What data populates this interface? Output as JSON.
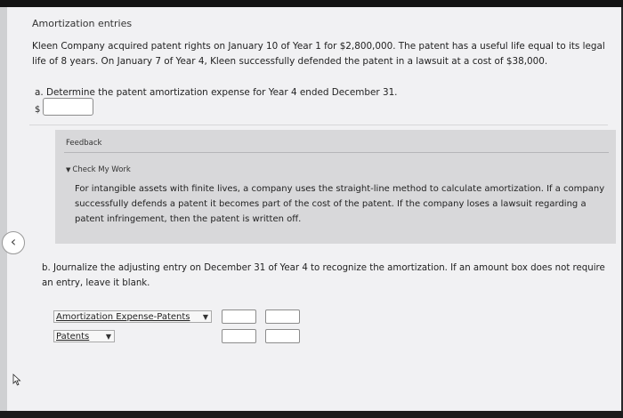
{
  "page": {
    "title": "Amortization entries",
    "description": "Kleen Company acquired patent rights on January 10 of Year 1 for $2,800,000. The patent has a useful life equal to its legal life of 8 years. On January 7 of Year 4, Kleen successfully defended the patent in a lawsuit at a cost of $38,000."
  },
  "part_a": {
    "question": "a. Determine the patent amortization expense for Year 4 ended December 31.",
    "currency_symbol": "$",
    "amount_value": ""
  },
  "feedback": {
    "label": "Feedback",
    "check_label": "Check My Work",
    "text": "For intangible assets with finite lives, a company uses the straight-line method to calculate amortization. If a company successfully defends a patent it becomes part of the cost of the patent. If the company loses a lawsuit regarding a patent infringement, then the patent is written off."
  },
  "part_b": {
    "question": "b. Journalize the adjusting entry on December 31 of Year 4 to recognize the amortization. If an amount box does not require an entry, leave it blank.",
    "rows": [
      {
        "account": "Amortization Expense-Patents",
        "debit": "",
        "credit": ""
      },
      {
        "account": "Patents",
        "debit": "",
        "credit": ""
      }
    ]
  },
  "icons": {
    "back": "chevron-left-icon",
    "dropdown": "caret-down-icon",
    "cursor": "mouse-pointer-icon"
  }
}
